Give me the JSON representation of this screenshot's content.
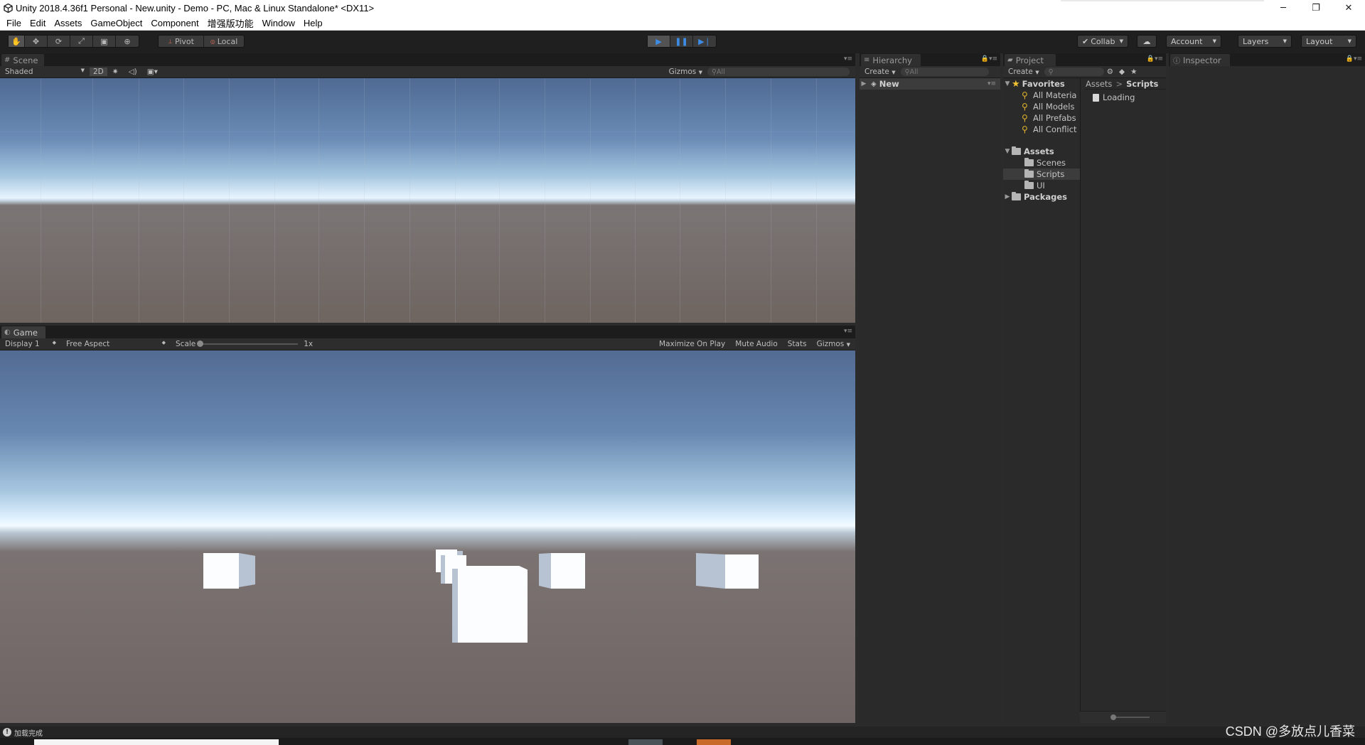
{
  "window": {
    "title": "Unity 2018.4.36f1 Personal - New.unity - Demo - PC, Mac & Linux Standalone* <DX11>",
    "minimize": "─",
    "restore": "❐",
    "close": "✕"
  },
  "menu": [
    "File",
    "Edit",
    "Assets",
    "GameObject",
    "Component",
    "增强版功能",
    "Window",
    "Help"
  ],
  "toolbar": {
    "pivot": "Pivot",
    "local": "Local",
    "collab": "Collab",
    "account": "Account",
    "layers": "Layers",
    "layout": "Layout"
  },
  "scene": {
    "tab": "Scene",
    "shading": "Shaded",
    "mode_2d": "2D",
    "gizmos": "Gizmos",
    "search_placeholder": "All"
  },
  "game": {
    "tab": "Game",
    "display": "Display 1",
    "aspect": "Free Aspect",
    "scale_label": "Scale",
    "scale_value": "1x",
    "maximize": "Maximize On Play",
    "mute": "Mute Audio",
    "stats": "Stats",
    "gizmos": "Gizmos"
  },
  "hierarchy": {
    "tab": "Hierarchy",
    "create": "Create",
    "search_placeholder": "All",
    "scene_name": "New"
  },
  "project": {
    "tab": "Project",
    "create": "Create",
    "favorites": "Favorites",
    "favorite_items": [
      "All Materia",
      "All Models",
      "All Prefabs",
      "All Conflict"
    ],
    "assets": "Assets",
    "asset_children": [
      "Scenes",
      "Scripts",
      "UI"
    ],
    "packages": "Packages",
    "breadcrumb_root": "Assets",
    "breadcrumb_sep": ">",
    "breadcrumb_current": "Scripts",
    "files": [
      "Loading"
    ]
  },
  "inspector": {
    "tab": "Inspector"
  },
  "status": {
    "message": "加载完成"
  },
  "watermark": "CSDN @多放点儿香菜",
  "colors": {
    "play_blue": "#3c8ce7",
    "favorite_gold": "#f1c232",
    "panel_bg": "#2a2a2a"
  }
}
